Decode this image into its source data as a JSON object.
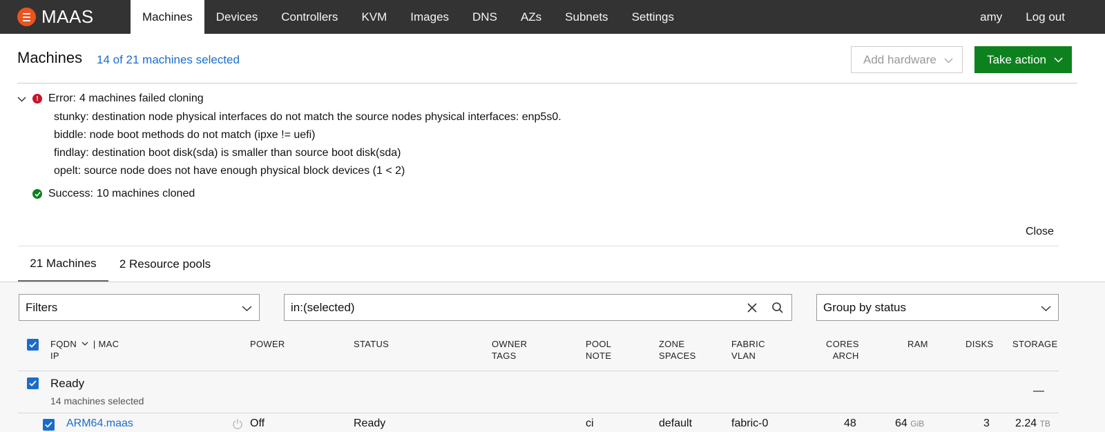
{
  "nav": {
    "brand": "MAAS",
    "items": [
      "Machines",
      "Devices",
      "Controllers",
      "KVM",
      "Images",
      "DNS",
      "AZs",
      "Subnets",
      "Settings"
    ],
    "user": "amy",
    "logout": "Log out"
  },
  "header": {
    "title": "Machines",
    "selected": "14 of 21 machines selected",
    "add_hardware": "Add hardware",
    "take_action": "Take action"
  },
  "notification": {
    "error_label": "Error:",
    "error_text": "4 machines failed cloning",
    "errors": [
      {
        "name": "stunky:",
        "msg": "destination node physical interfaces do not match the source nodes physical interfaces: enp5s0."
      },
      {
        "name": "biddle:",
        "msg": "node boot methods do not match (ipxe != uefi)"
      },
      {
        "name": "findlay:",
        "msg": "destination boot disk(sda) is smaller than source boot disk(sda)"
      },
      {
        "name": "opelt:",
        "msg": "source node does not have enough physical block devices (1 < 2)"
      }
    ],
    "success_label": "Success:",
    "success_text": "10 machines cloned",
    "close": "Close"
  },
  "tabs": [
    "21 Machines",
    "2 Resource pools"
  ],
  "filters": {
    "filters_label": "Filters",
    "search_value": "in:(selected)",
    "group_by": "Group by status"
  },
  "table": {
    "headers": {
      "fqdn": "FQDN",
      "mac": "| MAC",
      "ip": "IP",
      "power": "POWER",
      "status": "STATUS",
      "owner": "OWNER",
      "tags": "TAGS",
      "pool": "POOL",
      "note": "NOTE",
      "zone": "ZONE",
      "spaces": "SPACES",
      "fabric": "FABRIC",
      "vlan": "VLAN",
      "cores": "CORES",
      "arch": "ARCH",
      "ram": "RAM",
      "disks": "DISKS",
      "storage": "STORAGE"
    },
    "group": {
      "name": "Ready",
      "subtitle": "14 machines selected",
      "collapse": "—"
    },
    "partial_row": {
      "fqdn": "ARM64.maas",
      "power": "Off",
      "status": "Ready",
      "pool": "ci",
      "zone": "default",
      "fabric": "fabric-0",
      "cores": "48",
      "ram": "64",
      "ram_unit": "GiB",
      "disks": "3",
      "storage": "2.24",
      "storage_unit": "TB"
    }
  },
  "colors": {
    "nav_bg": "#333333",
    "brand_orange": "#e95420",
    "link_blue": "#1a6ccc",
    "action_green": "#0e811f",
    "error_red": "#c7162b",
    "success_green": "#0e811f"
  }
}
